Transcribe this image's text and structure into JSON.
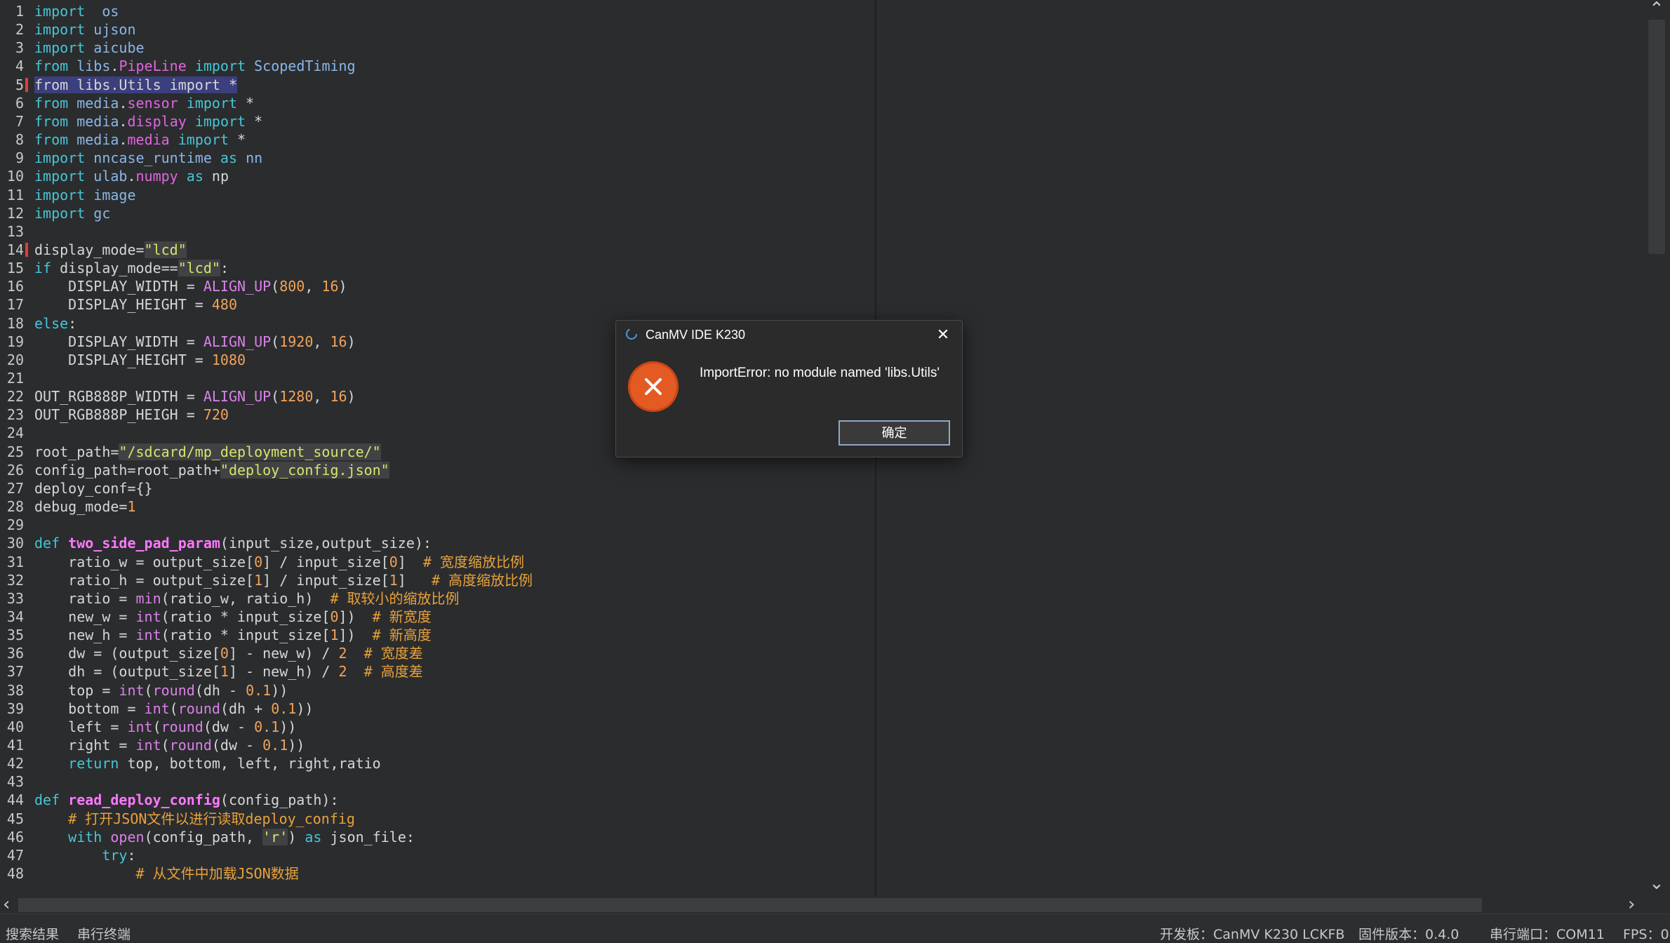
{
  "editor": {
    "lines": [
      {
        "n": "1",
        "s": [
          [
            "kw",
            "import"
          ],
          [
            "",
            "  "
          ],
          [
            "mod",
            "os"
          ]
        ]
      },
      {
        "n": "2",
        "s": [
          [
            "kw",
            "import"
          ],
          [
            "",
            " "
          ],
          [
            "mod",
            "ujson"
          ]
        ]
      },
      {
        "n": "3",
        "s": [
          [
            "kw",
            "import"
          ],
          [
            "",
            " "
          ],
          [
            "mod",
            "aicube"
          ]
        ]
      },
      {
        "n": "4",
        "s": [
          [
            "kw",
            "from"
          ],
          [
            "",
            " "
          ],
          [
            "mod",
            "libs"
          ],
          [
            "",
            "."
          ],
          [
            "cls",
            "PipeLine"
          ],
          [
            "",
            " "
          ],
          [
            "kw",
            "import"
          ],
          [
            "",
            " "
          ],
          [
            "mod",
            "ScopedTiming"
          ]
        ]
      },
      {
        "n": "5",
        "mark": true,
        "sel": "from libs.Utils import *"
      },
      {
        "n": "6",
        "s": [
          [
            "kw",
            "from"
          ],
          [
            "",
            " "
          ],
          [
            "mod",
            "media"
          ],
          [
            "",
            "."
          ],
          [
            "cls",
            "sensor"
          ],
          [
            "",
            " "
          ],
          [
            "kw",
            "import"
          ],
          [
            "",
            " *"
          ]
        ]
      },
      {
        "n": "7",
        "s": [
          [
            "kw",
            "from"
          ],
          [
            "",
            " "
          ],
          [
            "mod",
            "media"
          ],
          [
            "",
            "."
          ],
          [
            "cls",
            "display"
          ],
          [
            "",
            " "
          ],
          [
            "kw",
            "import"
          ],
          [
            "",
            " *"
          ]
        ]
      },
      {
        "n": "8",
        "s": [
          [
            "kw",
            "from"
          ],
          [
            "",
            " "
          ],
          [
            "mod",
            "media"
          ],
          [
            "",
            "."
          ],
          [
            "cls",
            "media"
          ],
          [
            "",
            " "
          ],
          [
            "kw",
            "import"
          ],
          [
            "",
            " *"
          ]
        ]
      },
      {
        "n": "9",
        "s": [
          [
            "kw",
            "import"
          ],
          [
            "",
            " "
          ],
          [
            "mod",
            "nncase_runtime"
          ],
          [
            "",
            " "
          ],
          [
            "kw",
            "as"
          ],
          [
            "",
            " "
          ],
          [
            "mod",
            "nn"
          ]
        ]
      },
      {
        "n": "10",
        "s": [
          [
            "kw",
            "import"
          ],
          [
            "",
            " "
          ],
          [
            "mod",
            "ulab"
          ],
          [
            "",
            "."
          ],
          [
            "cls",
            "numpy"
          ],
          [
            "",
            " "
          ],
          [
            "kw",
            "as"
          ],
          [
            "",
            " np"
          ]
        ]
      },
      {
        "n": "11",
        "s": [
          [
            "kw",
            "import"
          ],
          [
            "",
            " "
          ],
          [
            "mod",
            "image"
          ]
        ]
      },
      {
        "n": "12",
        "s": [
          [
            "kw",
            "import"
          ],
          [
            "",
            " "
          ],
          [
            "mod",
            "gc"
          ]
        ]
      },
      {
        "n": "13",
        "s": []
      },
      {
        "n": "14",
        "mark": true,
        "s": [
          [
            "",
            "display_mode="
          ],
          [
            "str",
            "\"lcd\""
          ]
        ]
      },
      {
        "n": "15",
        "s": [
          [
            "kw",
            "if"
          ],
          [
            "",
            " display_mode=="
          ],
          [
            "str",
            "\"lcd\""
          ],
          [
            "",
            ":"
          ]
        ]
      },
      {
        "n": "16",
        "s": [
          [
            "",
            "    DISPLAY_WIDTH = "
          ],
          [
            "bi",
            "ALIGN_UP"
          ],
          [
            "",
            "("
          ],
          [
            "num",
            "800"
          ],
          [
            "",
            ", "
          ],
          [
            "num",
            "16"
          ],
          [
            "",
            ")"
          ]
        ]
      },
      {
        "n": "17",
        "s": [
          [
            "",
            "    DISPLAY_HEIGHT = "
          ],
          [
            "num",
            "480"
          ]
        ]
      },
      {
        "n": "18",
        "s": [
          [
            "kw",
            "else"
          ],
          [
            "",
            ":"
          ]
        ]
      },
      {
        "n": "19",
        "s": [
          [
            "",
            "    DISPLAY_WIDTH = "
          ],
          [
            "bi",
            "ALIGN_UP"
          ],
          [
            "",
            "("
          ],
          [
            "num",
            "1920"
          ],
          [
            "",
            ", "
          ],
          [
            "num",
            "16"
          ],
          [
            "",
            ")"
          ]
        ]
      },
      {
        "n": "20",
        "s": [
          [
            "",
            "    DISPLAY_HEIGHT = "
          ],
          [
            "num",
            "1080"
          ]
        ]
      },
      {
        "n": "21",
        "s": []
      },
      {
        "n": "22",
        "s": [
          [
            "",
            "OUT_RGB888P_WIDTH = "
          ],
          [
            "bi",
            "ALIGN_UP"
          ],
          [
            "",
            "("
          ],
          [
            "num",
            "1280"
          ],
          [
            "",
            ", "
          ],
          [
            "num",
            "16"
          ],
          [
            "",
            ")"
          ]
        ]
      },
      {
        "n": "23",
        "s": [
          [
            "",
            "OUT_RGB888P_HEIGH = "
          ],
          [
            "num",
            "720"
          ]
        ]
      },
      {
        "n": "24",
        "s": []
      },
      {
        "n": "25",
        "s": [
          [
            "",
            "root_path="
          ],
          [
            "str",
            "\"/sdcard/mp_deployment_source/\""
          ]
        ]
      },
      {
        "n": "26",
        "s": [
          [
            "",
            "config_path=root_path+"
          ],
          [
            "str",
            "\"deploy_config.json\""
          ]
        ]
      },
      {
        "n": "27",
        "s": [
          [
            "",
            "deploy_conf={}"
          ]
        ]
      },
      {
        "n": "28",
        "s": [
          [
            "",
            "debug_mode="
          ],
          [
            "num",
            "1"
          ]
        ]
      },
      {
        "n": "29",
        "s": []
      },
      {
        "n": "30",
        "s": [
          [
            "kw",
            "def"
          ],
          [
            "",
            " "
          ],
          [
            "fn",
            "two_side_pad_param"
          ],
          [
            "",
            "(input_size,output_size):"
          ]
        ]
      },
      {
        "n": "31",
        "s": [
          [
            "",
            "    ratio_w = output_size["
          ],
          [
            "num",
            "0"
          ],
          [
            "",
            "] / input_size["
          ],
          [
            "num",
            "0"
          ],
          [
            "",
            "]  "
          ],
          [
            "cm",
            "# 宽度缩放比例"
          ]
        ]
      },
      {
        "n": "32",
        "s": [
          [
            "",
            "    ratio_h = output_size["
          ],
          [
            "num",
            "1"
          ],
          [
            "",
            "] / input_size["
          ],
          [
            "num",
            "1"
          ],
          [
            "",
            "]   "
          ],
          [
            "cm",
            "# 高度缩放比例"
          ]
        ]
      },
      {
        "n": "33",
        "s": [
          [
            "",
            "    ratio = "
          ],
          [
            "bi",
            "min"
          ],
          [
            "",
            "(ratio_w, ratio_h)  "
          ],
          [
            "cm",
            "# 取较小的缩放比例"
          ]
        ]
      },
      {
        "n": "34",
        "s": [
          [
            "",
            "    new_w = "
          ],
          [
            "bi",
            "int"
          ],
          [
            "",
            "(ratio * input_size["
          ],
          [
            "num",
            "0"
          ],
          [
            "",
            "])  "
          ],
          [
            "cm",
            "# 新宽度"
          ]
        ]
      },
      {
        "n": "35",
        "s": [
          [
            "",
            "    new_h = "
          ],
          [
            "bi",
            "int"
          ],
          [
            "",
            "(ratio * input_size["
          ],
          [
            "num",
            "1"
          ],
          [
            "",
            "])  "
          ],
          [
            "cm",
            "# 新高度"
          ]
        ]
      },
      {
        "n": "36",
        "s": [
          [
            "",
            "    dw = (output_size["
          ],
          [
            "num",
            "0"
          ],
          [
            "",
            "] - new_w) / "
          ],
          [
            "num",
            "2"
          ],
          [
            "",
            "  "
          ],
          [
            "cm",
            "# 宽度差"
          ]
        ]
      },
      {
        "n": "37",
        "s": [
          [
            "",
            "    dh = (output_size["
          ],
          [
            "num",
            "1"
          ],
          [
            "",
            "] - new_h) / "
          ],
          [
            "num",
            "2"
          ],
          [
            "",
            "  "
          ],
          [
            "cm",
            "# 高度差"
          ]
        ]
      },
      {
        "n": "38",
        "s": [
          [
            "",
            "    top = "
          ],
          [
            "bi",
            "int"
          ],
          [
            "",
            "("
          ],
          [
            "bi",
            "round"
          ],
          [
            "",
            "(dh - "
          ],
          [
            "num",
            "0.1"
          ],
          [
            "",
            "))"
          ]
        ]
      },
      {
        "n": "39",
        "s": [
          [
            "",
            "    bottom = "
          ],
          [
            "bi",
            "int"
          ],
          [
            "",
            "("
          ],
          [
            "bi",
            "round"
          ],
          [
            "",
            "(dh + "
          ],
          [
            "num",
            "0.1"
          ],
          [
            "",
            "))"
          ]
        ]
      },
      {
        "n": "40",
        "s": [
          [
            "",
            "    left = "
          ],
          [
            "bi",
            "int"
          ],
          [
            "",
            "("
          ],
          [
            "bi",
            "round"
          ],
          [
            "",
            "(dw - "
          ],
          [
            "num",
            "0.1"
          ],
          [
            "",
            "))"
          ]
        ]
      },
      {
        "n": "41",
        "s": [
          [
            "",
            "    right = "
          ],
          [
            "bi",
            "int"
          ],
          [
            "",
            "("
          ],
          [
            "bi",
            "round"
          ],
          [
            "",
            "(dw - "
          ],
          [
            "num",
            "0.1"
          ],
          [
            "",
            "))"
          ]
        ]
      },
      {
        "n": "42",
        "s": [
          [
            "",
            "    "
          ],
          [
            "kw",
            "return"
          ],
          [
            "",
            " top, bottom, left, right,ratio"
          ]
        ]
      },
      {
        "n": "43",
        "s": []
      },
      {
        "n": "44",
        "s": [
          [
            "kw",
            "def"
          ],
          [
            "",
            " "
          ],
          [
            "fn",
            "read_deploy_config"
          ],
          [
            "",
            "(config_path):"
          ]
        ]
      },
      {
        "n": "45",
        "s": [
          [
            "",
            "    "
          ],
          [
            "cm",
            "# 打开JSON文件以进行读取deploy_config"
          ]
        ]
      },
      {
        "n": "46",
        "s": [
          [
            "",
            "    "
          ],
          [
            "kw",
            "with"
          ],
          [
            "",
            " "
          ],
          [
            "bi",
            "open"
          ],
          [
            "",
            "(config_path, "
          ],
          [
            "str",
            "'r'"
          ],
          [
            "",
            ") "
          ],
          [
            "kw",
            "as"
          ],
          [
            "",
            " json_file:"
          ]
        ]
      },
      {
        "n": "47",
        "s": [
          [
            "",
            "        "
          ],
          [
            "kw",
            "try"
          ],
          [
            "",
            ":"
          ]
        ]
      },
      {
        "n": "48",
        "s": [
          [
            "",
            "            "
          ],
          [
            "cm",
            "# 从文件中加载JSON数据"
          ]
        ]
      }
    ]
  },
  "status_bar": {
    "search_results": "搜索结果",
    "serial_terminal": "串行终端",
    "board": "开发板：CanMV K230 LCKFB",
    "firmware": "固件版本：0.4.0",
    "serial_port": "串行端口：COM11",
    "fps": "FPS：0"
  },
  "dialog": {
    "title": "CanMV IDE K230",
    "message": "ImportError: no module named 'libs.Utils'",
    "ok_label": "确定",
    "icon": "error-icon",
    "accent_color": "#e35a22"
  }
}
